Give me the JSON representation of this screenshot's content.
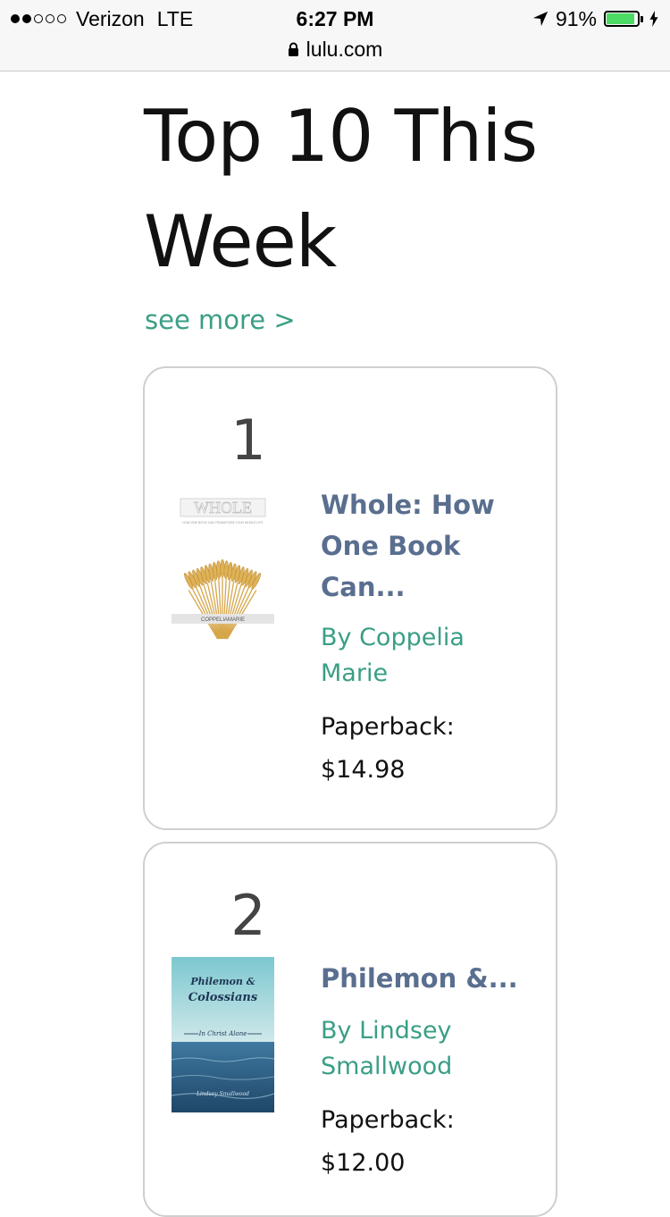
{
  "status_bar": {
    "carrier": "Verizon",
    "network": "LTE",
    "time": "6:27 PM",
    "battery_percent": "91%",
    "battery_level": 0.91,
    "signal_bars_filled": 2,
    "signal_bars_total": 5
  },
  "browser": {
    "url": "lulu.com"
  },
  "section": {
    "title": "Top 10 This Week",
    "see_more": "see more >"
  },
  "books": [
    {
      "rank": "1",
      "title": "Whole: How One Book Can...",
      "author": "By Coppelia Marie",
      "format": "Paperback:",
      "price": "$14.98",
      "cover": {
        "heading": "WHOLE",
        "subtitle": "HOW ONE BOOK CAN TRANSFORM YOUR WHOLE LIFE",
        "author_band": "COPPELIAMARIE",
        "accent": "#d9a441"
      }
    },
    {
      "rank": "2",
      "title": "Philemon &...",
      "author": "By Lindsey Smallwood",
      "format": "Paperback:",
      "price": "$12.00",
      "cover": {
        "line1": "Philemon &",
        "line2": "Colossians",
        "tagline": "In Christ Alone",
        "author_script": "Lindsey Smallwood",
        "sky": "#8fd0d6",
        "sea": "#2d5c86"
      }
    }
  ],
  "colors": {
    "accent_green": "#3a9e86",
    "title_blue": "#5a6f8f",
    "battery_green": "#4cd964"
  }
}
